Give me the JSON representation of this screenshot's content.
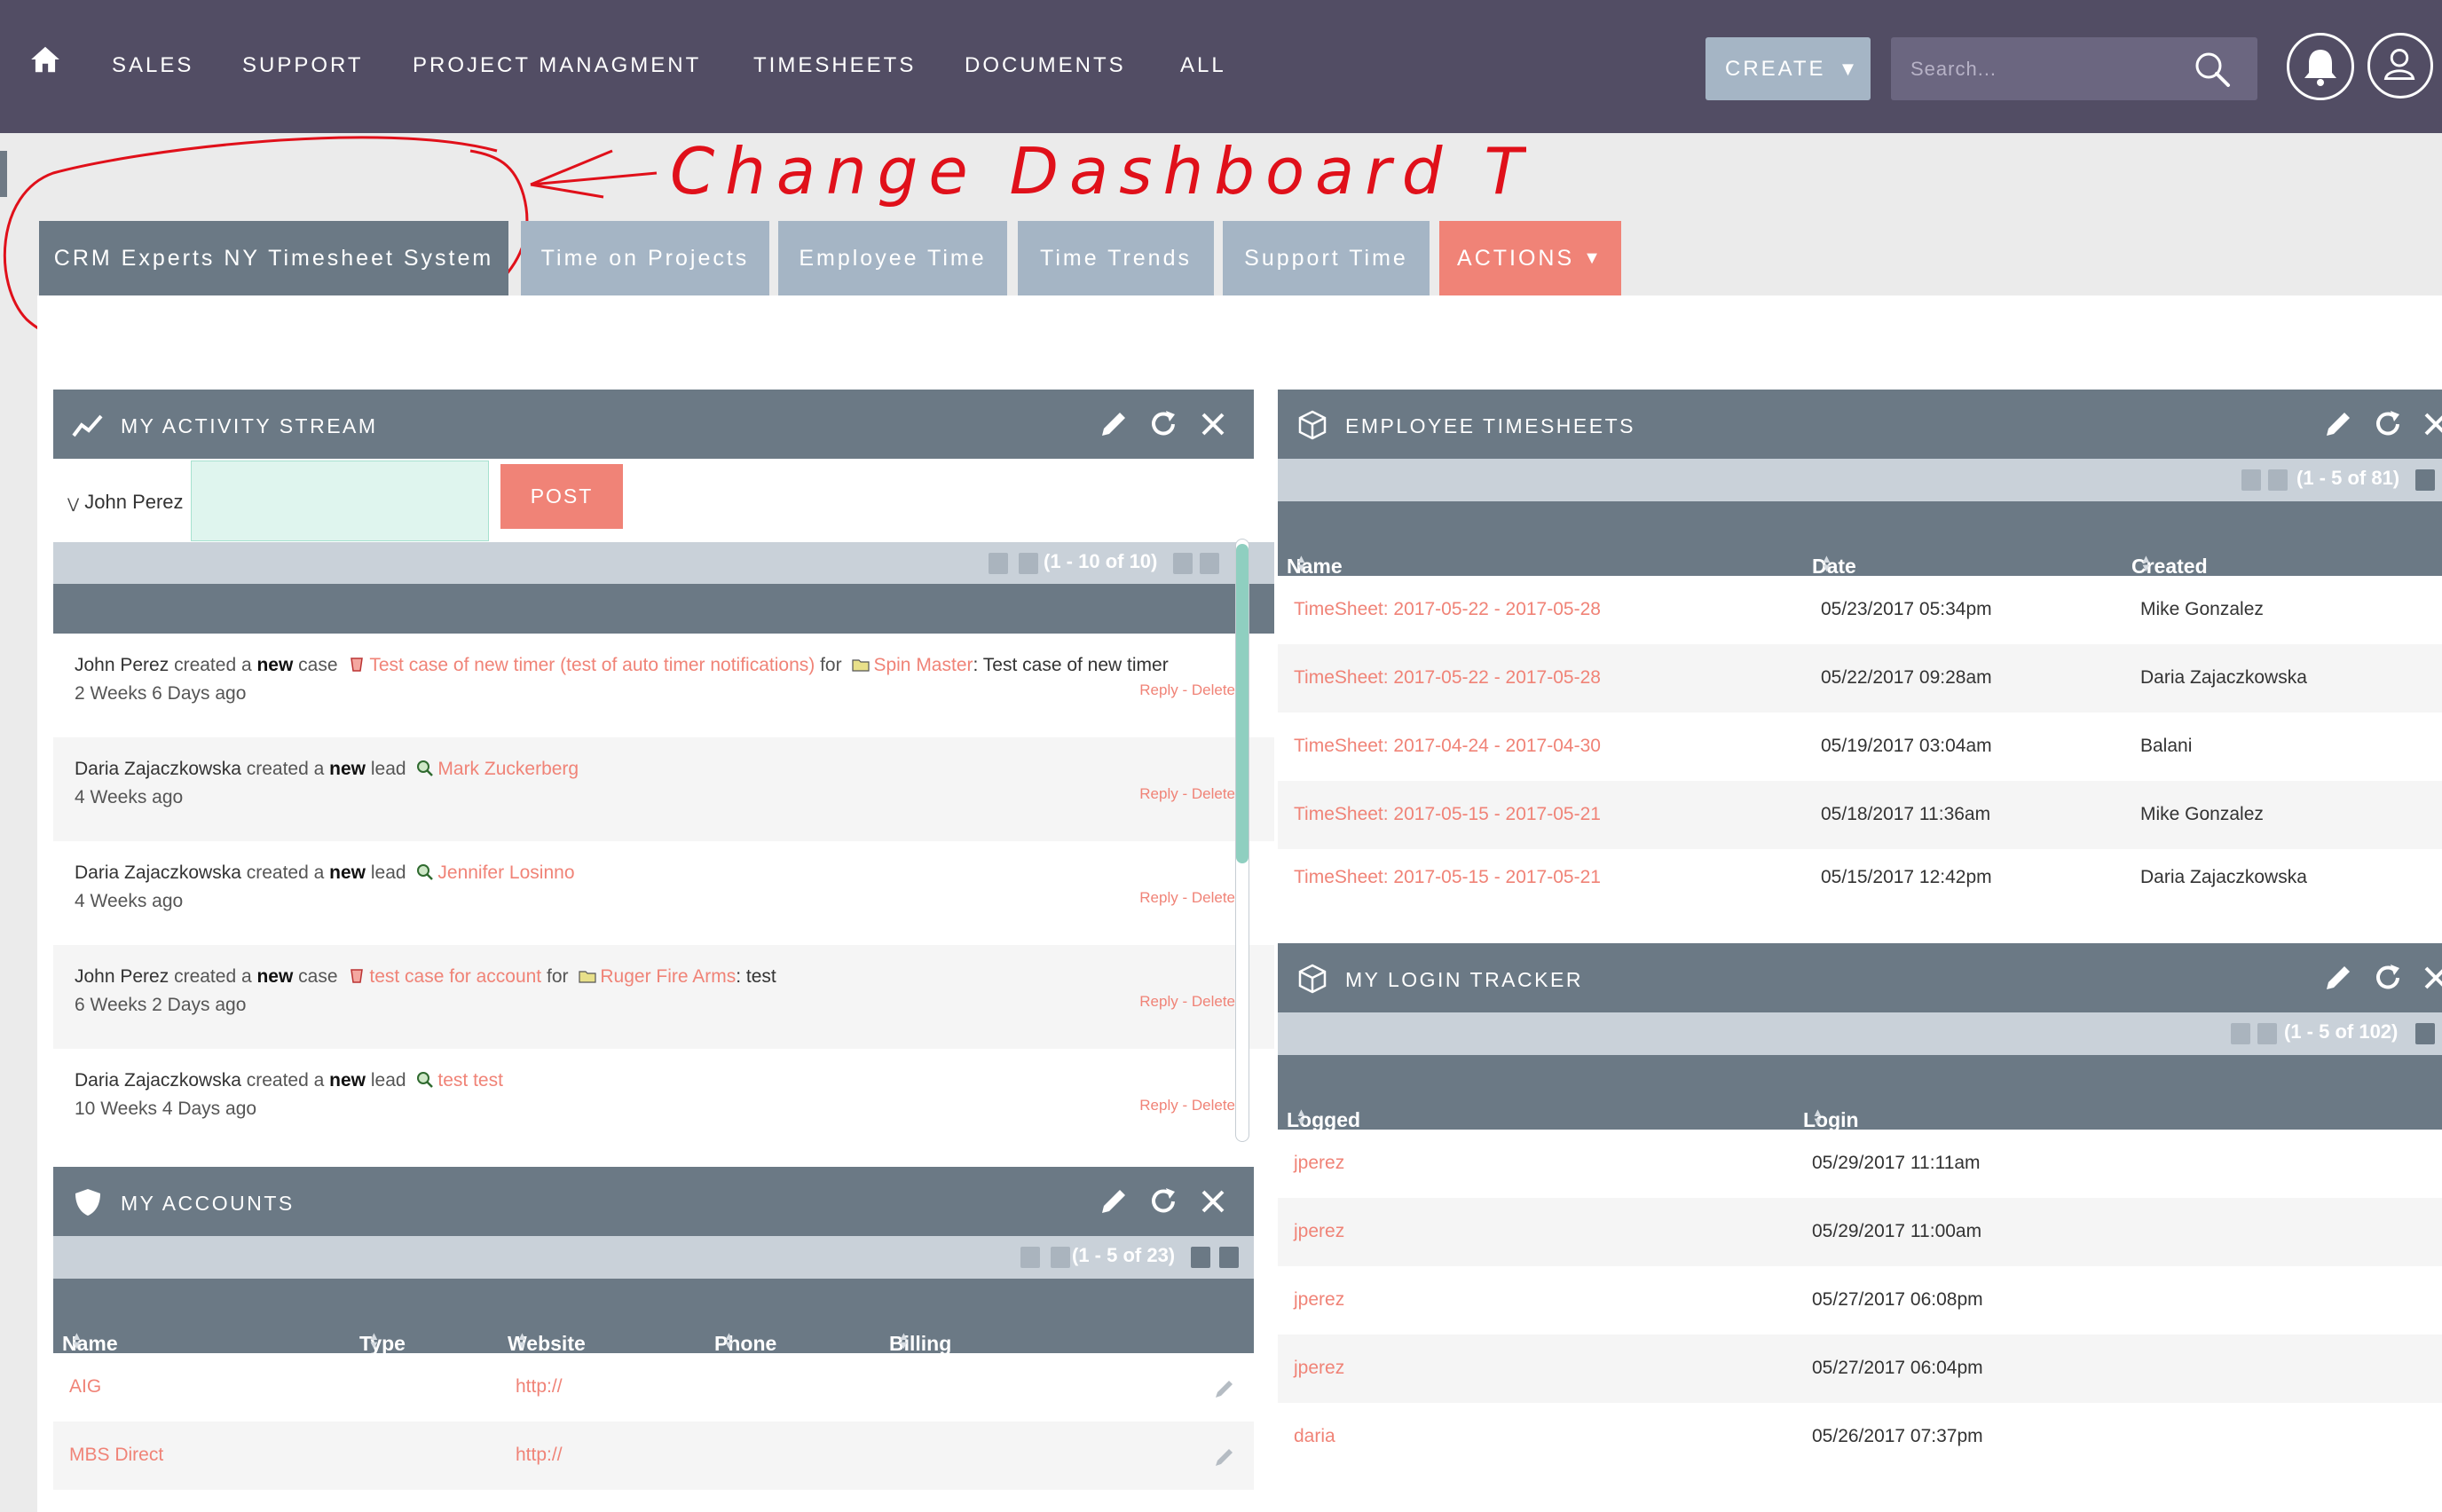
{
  "nav": {
    "items": [
      "SALES",
      "SUPPORT",
      "PROJECT MANAGMENT",
      "TIMESHEETS",
      "DOCUMENTS",
      "ALL"
    ],
    "create_label": "CREATE",
    "search_placeholder": "Search..."
  },
  "annotation": {
    "text": "Change Dashboard Text"
  },
  "tabs": [
    {
      "label": "CRM Experts NY Timesheet System"
    },
    {
      "label": "Time on Projects"
    },
    {
      "label": "Employee Time"
    },
    {
      "label": "Time Trends"
    },
    {
      "label": "Support Time"
    },
    {
      "label": "ACTIONS"
    }
  ],
  "activity": {
    "title": "MY ACTIVITY STREAM",
    "user": "John Perez",
    "post_label": "POST",
    "pager": "(1 - 10 of 10)",
    "reply": "Reply",
    "delete": "Delete",
    "items": [
      {
        "user": "John Perez",
        "verb": "created a",
        "new": "new",
        "type": "case",
        "link": "Test case of new timer (test of auto timer notifications)",
        "for": "for",
        "account": "Spin Master",
        "suffix": ": Test case of new timer",
        "time": "2 Weeks 6 Days ago"
      },
      {
        "user": "Daria Zajaczkowska",
        "verb": "created a",
        "new": "new",
        "type": "lead",
        "link": "Mark Zuckerberg",
        "time": "4 Weeks ago"
      },
      {
        "user": "Daria Zajaczkowska",
        "verb": "created a",
        "new": "new",
        "type": "lead",
        "link": "Jennifer Losinno",
        "time": "4 Weeks ago"
      },
      {
        "user": "John Perez",
        "verb": "created a",
        "new": "new",
        "type": "case",
        "link": "test case for account",
        "for": "for",
        "account": "Ruger Fire Arms",
        "suffix": ": test",
        "time": "6 Weeks 2 Days ago"
      },
      {
        "user": "Daria Zajaczkowska",
        "verb": "created a",
        "new": "new",
        "type": "lead",
        "link": "test test",
        "time": "10 Weeks 4 Days ago"
      }
    ]
  },
  "accounts": {
    "title": "MY ACCOUNTS",
    "pager": "(1 - 5 of 23)",
    "columns": [
      "Name",
      "Type",
      "Website",
      "Phone",
      "Billing Country"
    ],
    "rows": [
      {
        "name": "AIG",
        "website": "http://"
      },
      {
        "name": "MBS Direct",
        "website": "http://"
      }
    ]
  },
  "timesheets": {
    "title": "EMPLOYEE TIMESHEETS",
    "pager": "(1 - 5 of 81)",
    "columns": [
      "Name",
      "Date Created",
      "Created By"
    ],
    "rows": [
      {
        "name": "TimeSheet: 2017-05-22 - 2017-05-28",
        "date": "05/23/2017 05:34pm",
        "by": "Mike Gonzalez"
      },
      {
        "name": "TimeSheet: 2017-05-22 - 2017-05-28",
        "date": "05/22/2017 09:28am",
        "by": "Daria Zajaczkowska"
      },
      {
        "name": "TimeSheet: 2017-04-24 - 2017-04-30",
        "date": "05/19/2017 03:04am",
        "by": "Balani"
      },
      {
        "name": "TimeSheet: 2017-05-15 - 2017-05-21",
        "date": "05/18/2017 11:36am",
        "by": "Mike Gonzalez"
      },
      {
        "name": "TimeSheet: 2017-05-15 - 2017-05-21",
        "date": "05/15/2017 12:42pm",
        "by": "Daria Zajaczkowska"
      }
    ]
  },
  "login": {
    "title": "MY LOGIN TRACKER",
    "pager": "(1 - 5 of 102)",
    "columns": [
      "Logged In User",
      "Login Time"
    ],
    "rows": [
      {
        "user": "jperez",
        "time": "05/29/2017 11:11am"
      },
      {
        "user": "jperez",
        "time": "05/29/2017 11:00am"
      },
      {
        "user": "jperez",
        "time": "05/27/2017 06:08pm"
      },
      {
        "user": "jperez",
        "time": "05/27/2017 06:04pm"
      },
      {
        "user": "daria",
        "time": "05/26/2017 07:37pm"
      }
    ]
  },
  "colors": {
    "nav_bg": "#524d64",
    "tab": "#a5b5c5",
    "tab_active": "#6b7985",
    "accent": "#f08377",
    "annotation": "#e0101a"
  }
}
